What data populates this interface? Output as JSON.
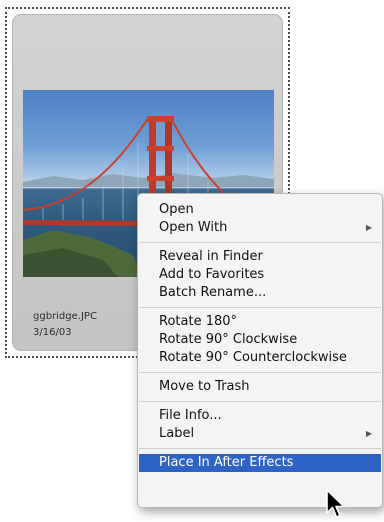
{
  "thumbnail": {
    "file_name": "ggbridge.JPC",
    "file_date": "3/16/03"
  },
  "context_menu": {
    "groups": [
      [
        {
          "label": "Open",
          "submenu": false
        },
        {
          "label": "Open With",
          "submenu": true
        }
      ],
      [
        {
          "label": "Reveal in Finder",
          "submenu": false
        },
        {
          "label": "Add to Favorites",
          "submenu": false
        },
        {
          "label": "Batch Rename...",
          "submenu": false
        }
      ],
      [
        {
          "label": "Rotate 180°",
          "submenu": false
        },
        {
          "label": "Rotate 90° Clockwise",
          "submenu": false
        },
        {
          "label": "Rotate 90° Counterclockwise",
          "submenu": false
        }
      ],
      [
        {
          "label": "Move to Trash",
          "submenu": false
        }
      ],
      [
        {
          "label": "File Info...",
          "submenu": false
        },
        {
          "label": "Label",
          "submenu": true
        }
      ],
      [
        {
          "label": "Place In After Effects",
          "submenu": false,
          "highlighted": true
        }
      ]
    ],
    "submenu_arrow": "▶"
  },
  "colors": {
    "highlight": "#2d63c4",
    "menu_background": "#f4f4f4"
  },
  "icons": {
    "cursor": "arrow-cursor-icon",
    "submenu": "submenu-arrow-icon"
  }
}
